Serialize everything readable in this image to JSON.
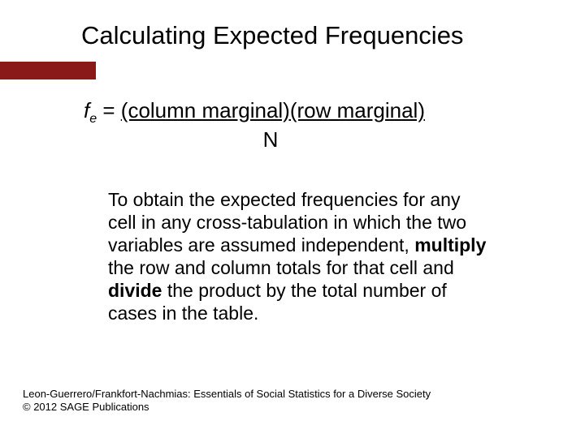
{
  "title": "Calculating Expected Frequencies",
  "formula": {
    "lhs_var": "f",
    "lhs_sub": "e",
    "equals": " = ",
    "numerator": "(column marginal)(row marginal)",
    "denominator": "N"
  },
  "paragraph": {
    "part1": "To obtain the expected frequencies for any cell in any cross-tabulation in which the two variables are assumed independent, ",
    "bold1": "multiply",
    "part2": " the row and column totals for that cell and ",
    "bold2": "divide",
    "part3": " the product by the total number of cases in the table."
  },
  "footer": {
    "line1": "Leon-Guerrero/Frankfort-Nachmias: Essentials of Social Statistics for a Diverse Society",
    "line2": "© 2012 SAGE Publications"
  }
}
